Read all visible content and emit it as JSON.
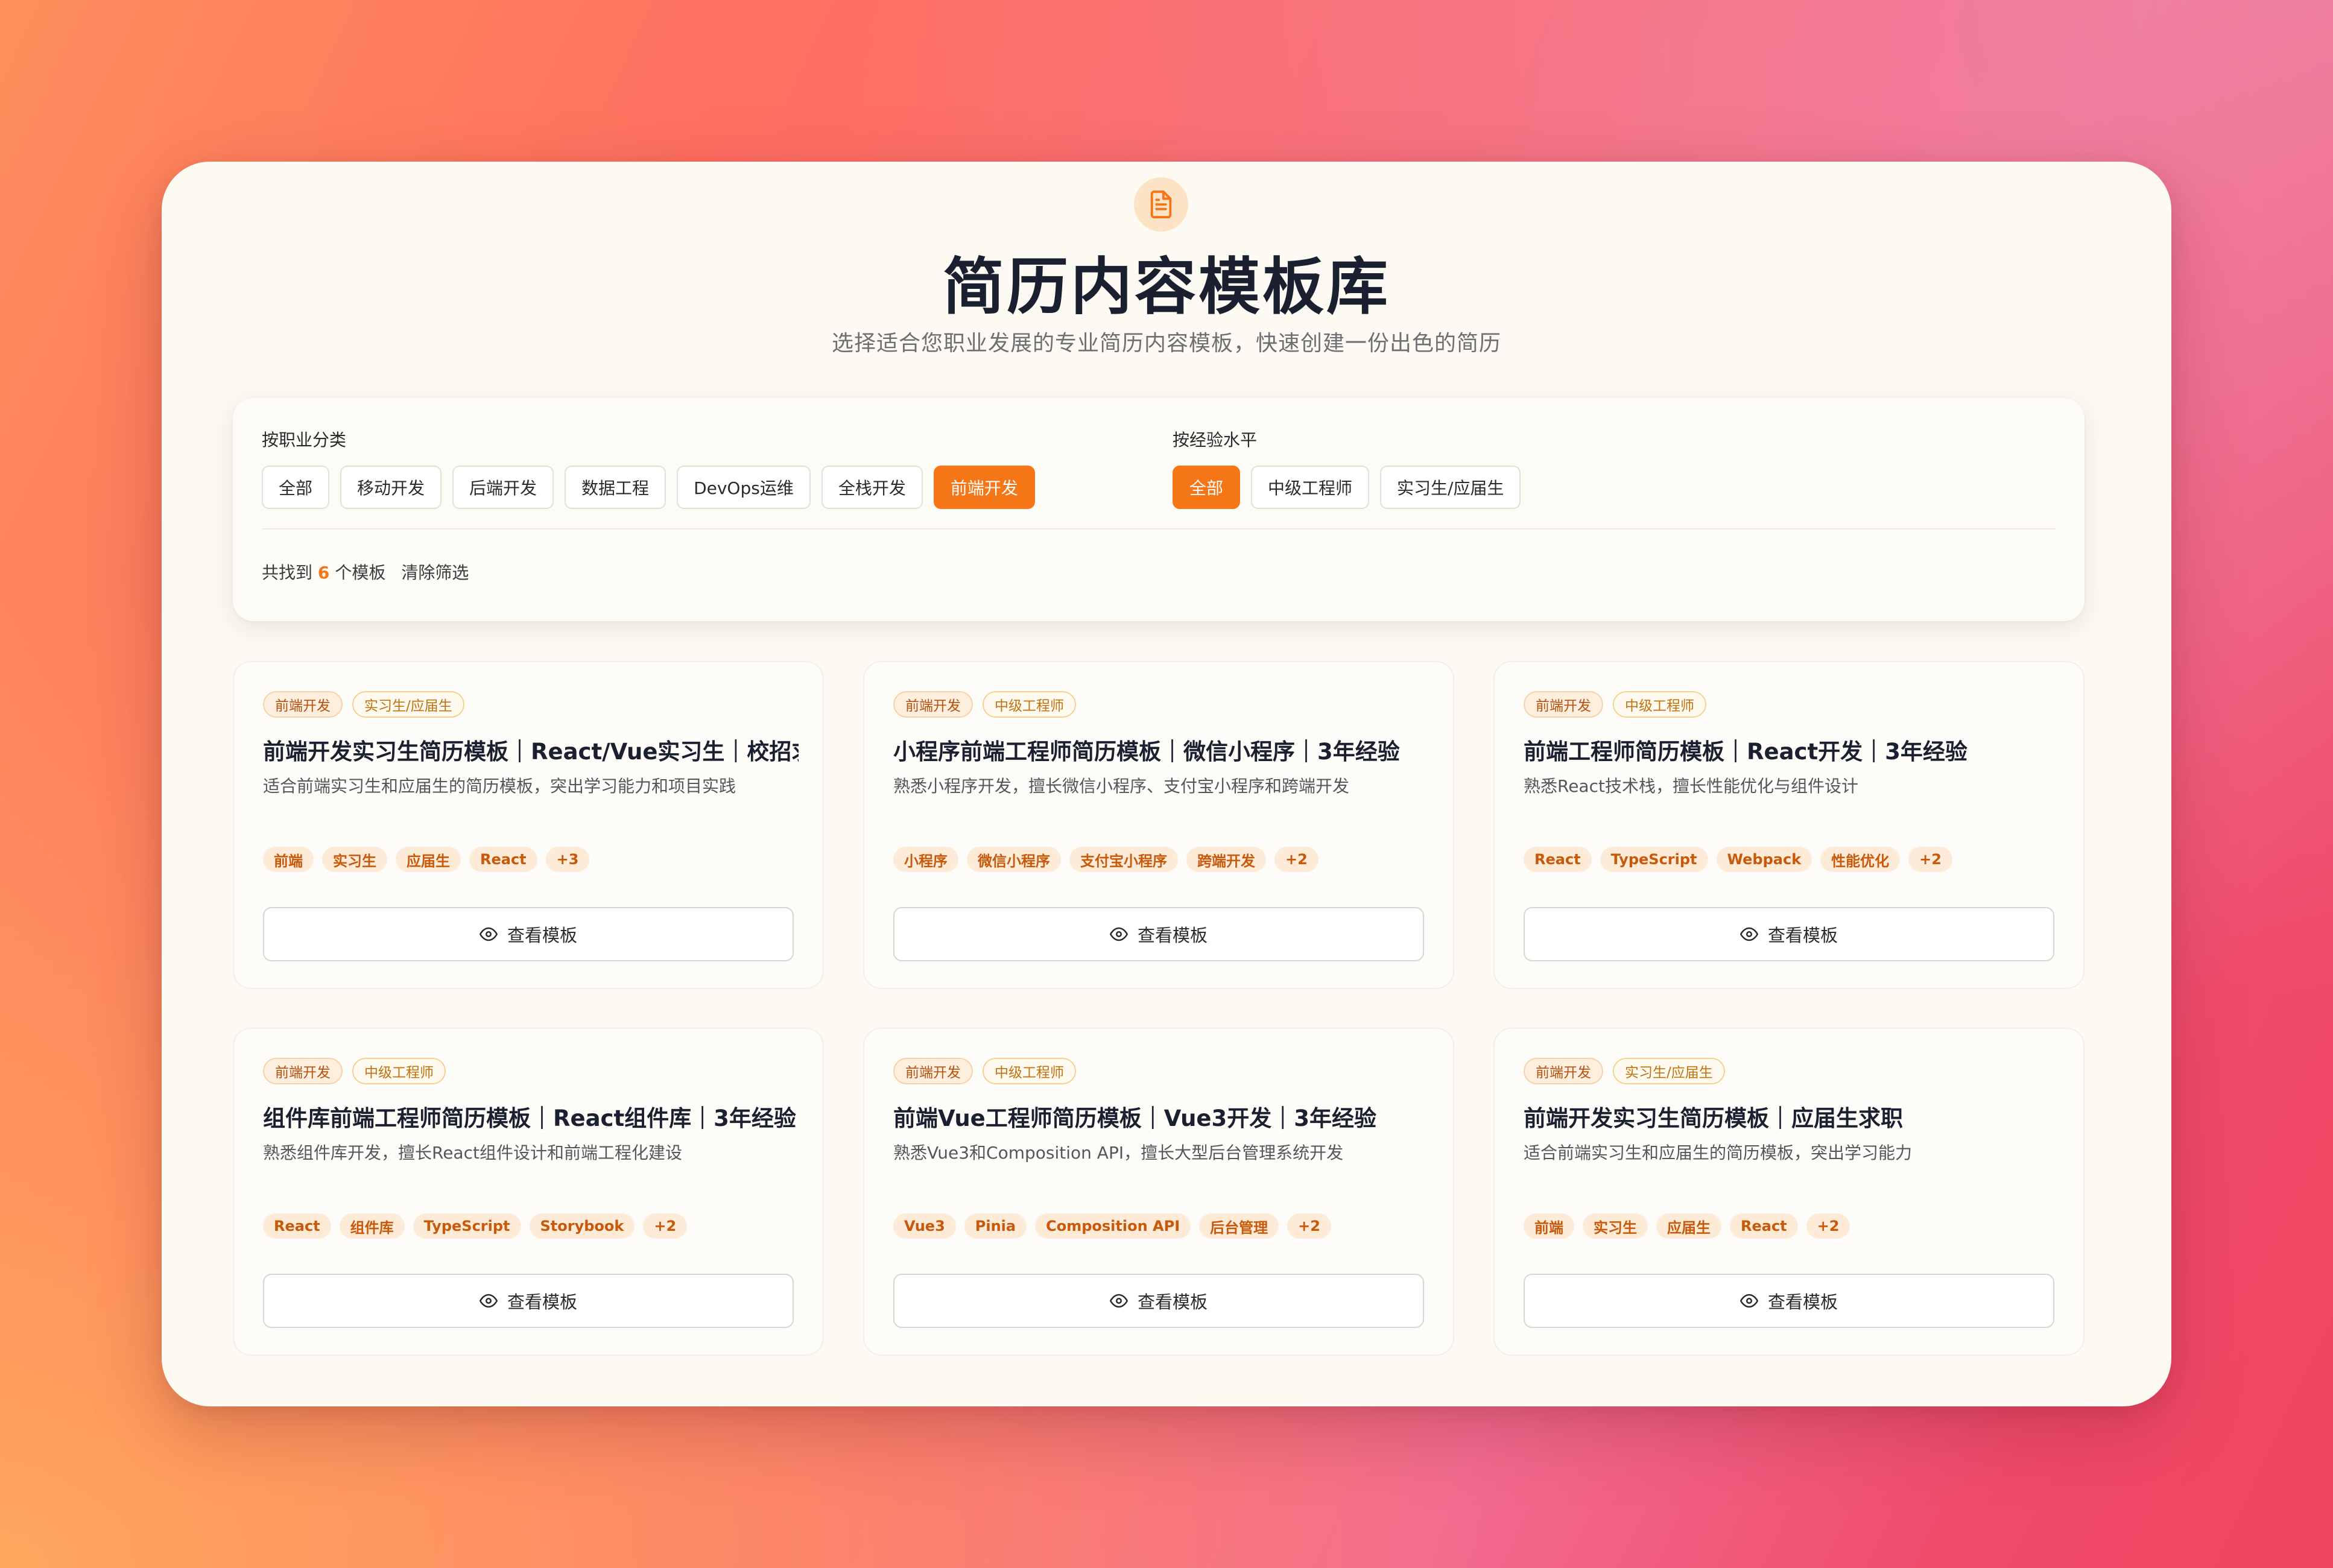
{
  "header": {
    "icon": "document-icon",
    "title": "简历内容模板库",
    "subtitle": "选择适合您职业发展的专业简历内容模板，快速创建一份出色的简历"
  },
  "filters": {
    "career": {
      "label": "按职业分类",
      "options": [
        "全部",
        "移动开发",
        "后端开发",
        "数据工程",
        "DevOps运维",
        "全栈开发",
        "前端开发"
      ],
      "selected": "前端开发"
    },
    "experience": {
      "label": "按经验水平",
      "options": [
        "全部",
        "中级工程师",
        "实习生/应届生"
      ],
      "selected": "全部"
    },
    "results": {
      "prefix": "共找到",
      "count": "6",
      "suffix": "个模板",
      "clear_label": "清除筛选"
    }
  },
  "cards": [
    {
      "category": "前端开发",
      "level": "实习生/应届生",
      "title": "前端开发实习生简历模板｜React/Vue实习生｜校招求职",
      "description": "适合前端实习生和应届生的简历模板，突出学习能力和项目实践",
      "tags": [
        "前端",
        "实习生",
        "应届生",
        "React",
        "+3"
      ],
      "button": "查看模板"
    },
    {
      "category": "前端开发",
      "level": "中级工程师",
      "title": "小程序前端工程师简历模板｜微信小程序｜3年经验",
      "description": "熟悉小程序开发，擅长微信小程序、支付宝小程序和跨端开发",
      "tags": [
        "小程序",
        "微信小程序",
        "支付宝小程序",
        "跨端开发",
        "+2"
      ],
      "button": "查看模板"
    },
    {
      "category": "前端开发",
      "level": "中级工程师",
      "title": "前端工程师简历模板｜React开发｜3年经验",
      "description": "熟悉React技术栈，擅长性能优化与组件设计",
      "tags": [
        "React",
        "TypeScript",
        "Webpack",
        "性能优化",
        "+2"
      ],
      "button": "查看模板"
    },
    {
      "category": "前端开发",
      "level": "中级工程师",
      "title": "组件库前端工程师简历模板｜React组件库｜3年经验",
      "description": "熟悉组件库开发，擅长React组件设计和前端工程化建设",
      "tags": [
        "React",
        "组件库",
        "TypeScript",
        "Storybook",
        "+2"
      ],
      "button": "查看模板"
    },
    {
      "category": "前端开发",
      "level": "中级工程师",
      "title": "前端Vue工程师简历模板｜Vue3开发｜3年经验",
      "description": "熟悉Vue3和Composition API，擅长大型后台管理系统开发",
      "tags": [
        "Vue3",
        "Pinia",
        "Composition API",
        "后台管理",
        "+2"
      ],
      "button": "查看模板"
    },
    {
      "category": "前端开发",
      "level": "实习生/应届生",
      "title": "前端开发实习生简历模板｜应届生求职",
      "description": "适合前端实习生和应届生的简历模板，突出学习能力",
      "tags": [
        "前端",
        "实习生",
        "应届生",
        "React",
        "+2"
      ],
      "button": "查看模板"
    }
  ],
  "colors": {
    "accent": "#f47617",
    "title": "#1b2030",
    "panel": "#fdfaf3"
  }
}
